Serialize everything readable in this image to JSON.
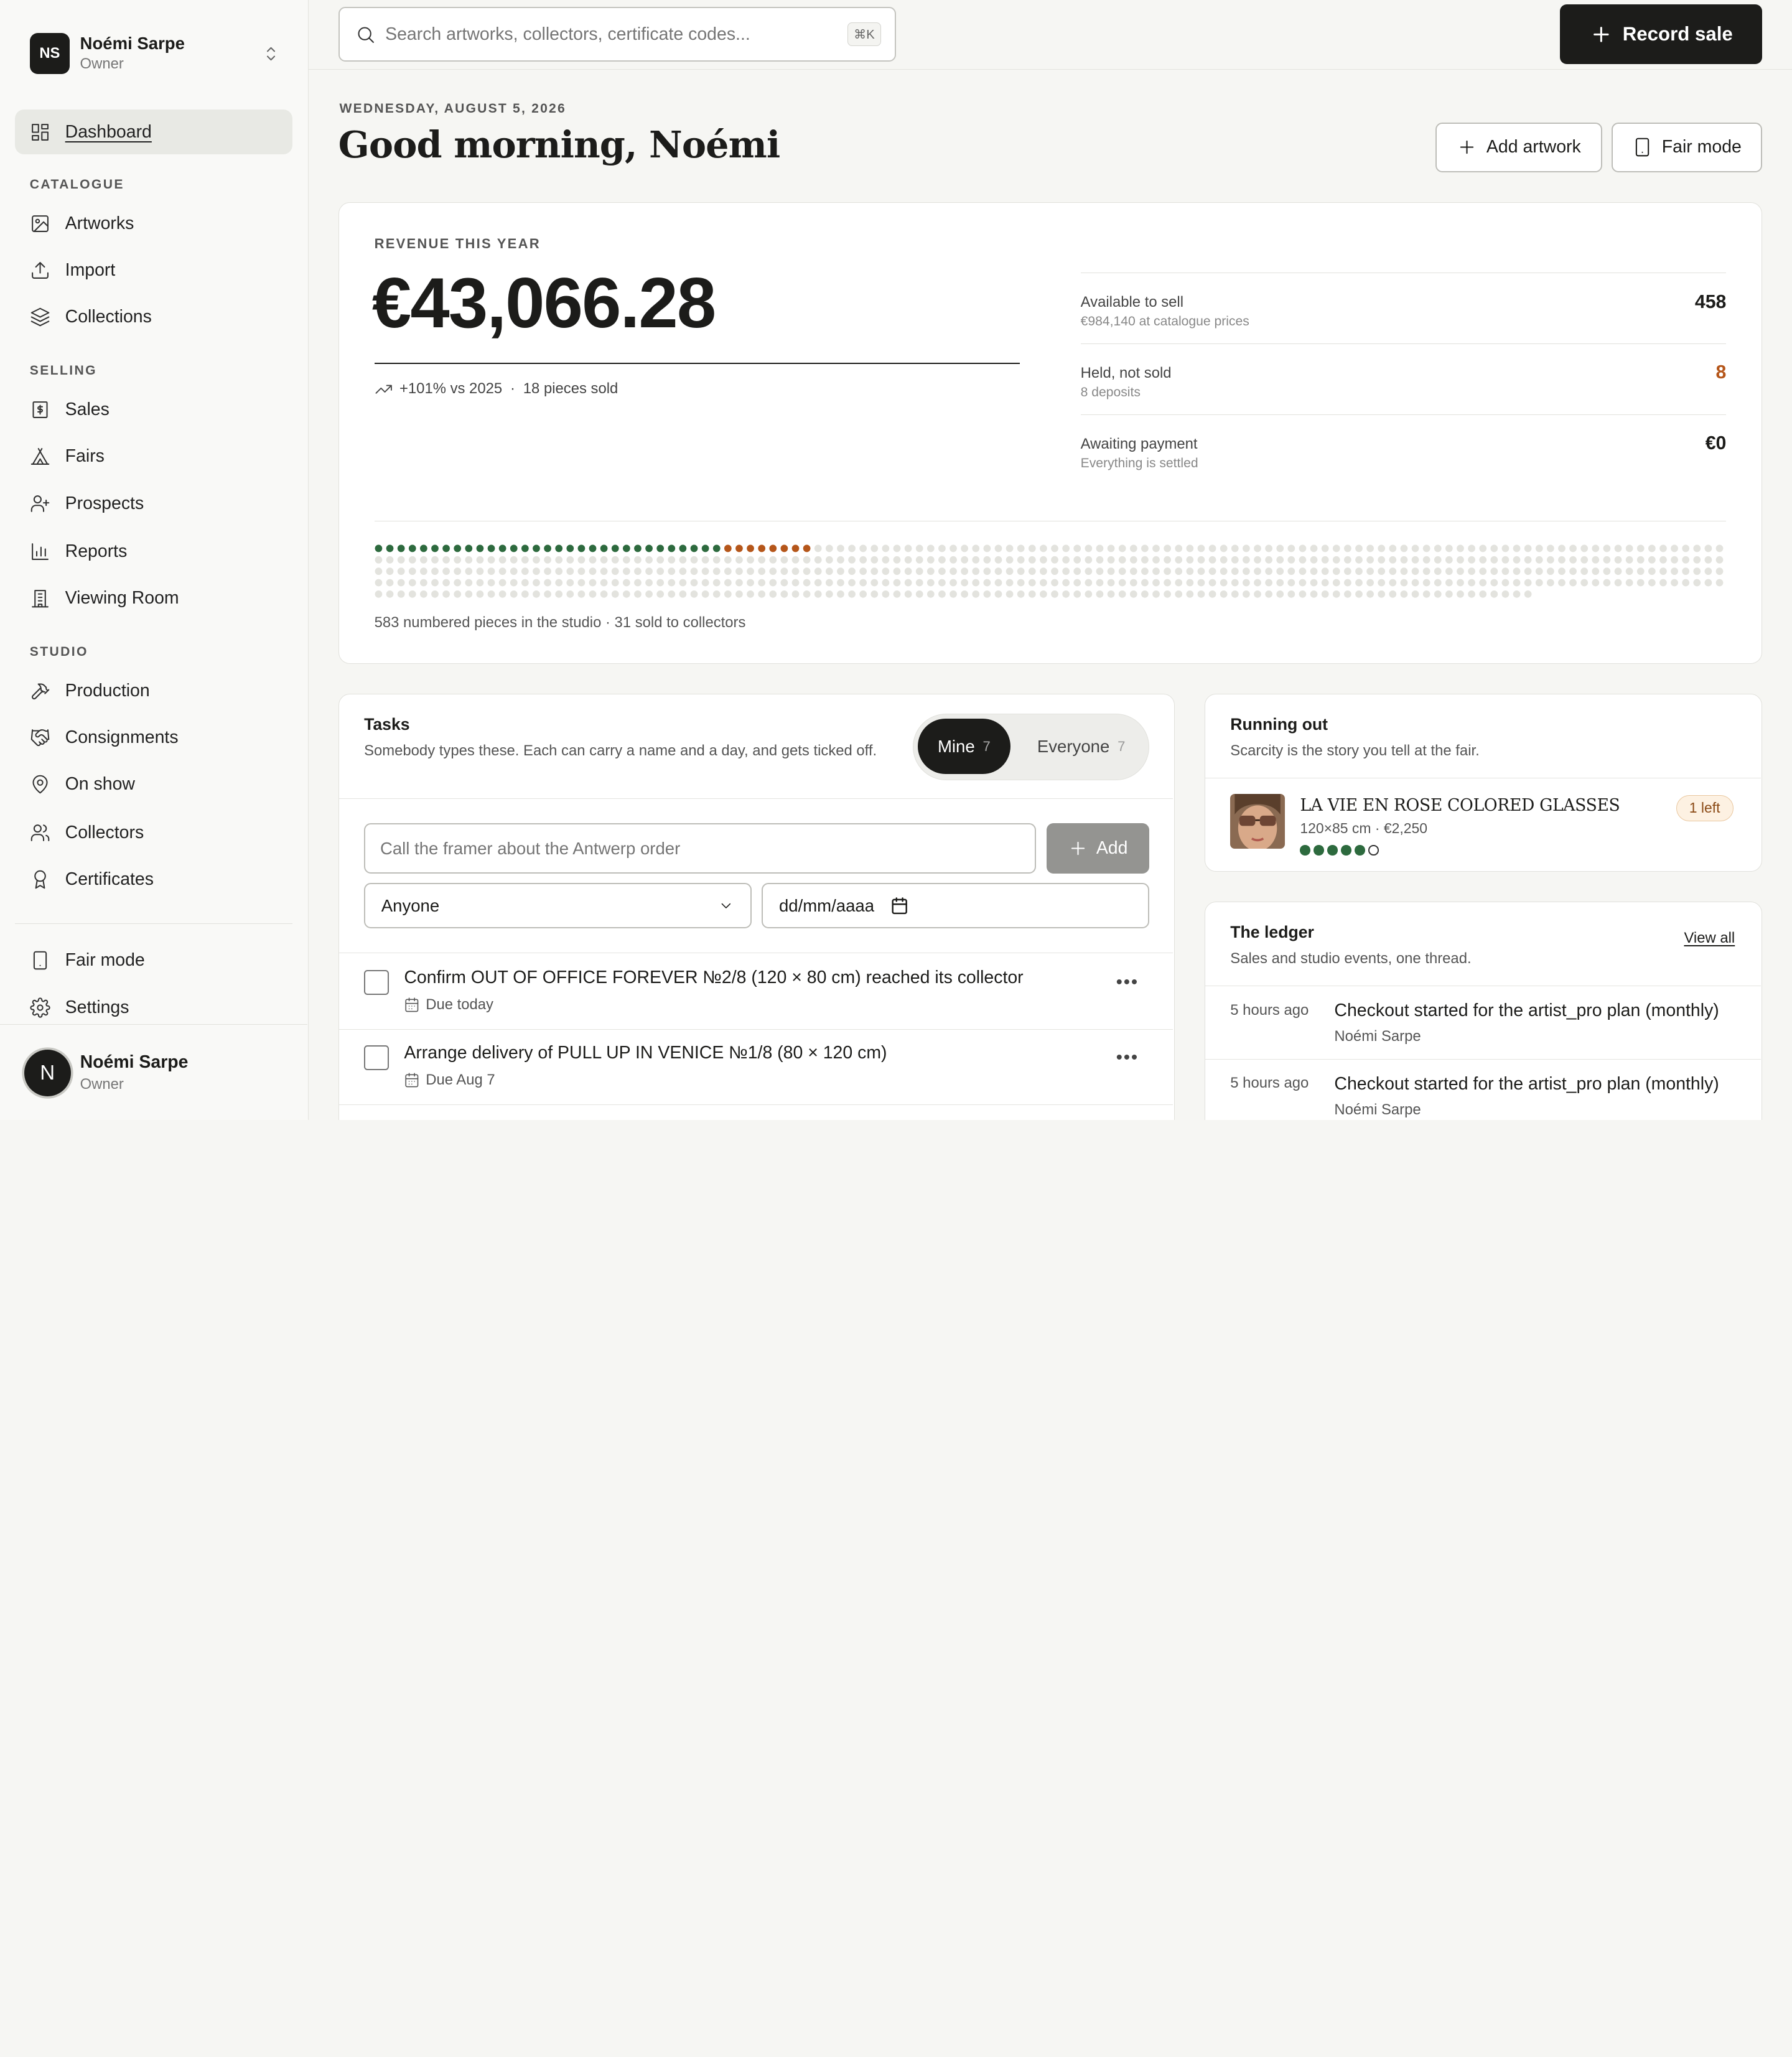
{
  "sidebar": {
    "org": {
      "initials": "NS",
      "name": "Noémi Sarpe",
      "role": "Owner"
    },
    "dashboard": "Dashboard",
    "sections": {
      "catalogue": "CATALOGUE",
      "selling": "SELLING",
      "studio": "STUDIO"
    },
    "catalogue": [
      "Artworks",
      "Import",
      "Collections"
    ],
    "selling": [
      "Sales",
      "Fairs",
      "Prospects",
      "Reports",
      "Viewing Room"
    ],
    "studio": [
      "Production",
      "Consignments",
      "On show",
      "Collectors",
      "Certificates"
    ],
    "bottom": [
      "Fair mode",
      "Settings"
    ],
    "user": {
      "initial": "N",
      "name": "Noémi Sarpe",
      "role": "Owner"
    }
  },
  "topbar": {
    "search_placeholder": "Search artworks, collectors, certificate codes...",
    "shortcut": "⌘K",
    "record_sale": "Record sale"
  },
  "header": {
    "date": "WEDNESDAY, AUGUST 5, 2026",
    "greeting": "Good morning, Noémi",
    "add_artwork": "Add artwork",
    "fair_mode": "Fair mode"
  },
  "revenue": {
    "label": "REVENUE THIS YEAR",
    "amount": "€43,066.28",
    "trend": "+101% vs 2025",
    "sep": "·",
    "pieces_sold": "18 pieces sold",
    "stats": [
      {
        "label": "Available to sell",
        "sub": "€984,140 at catalogue prices",
        "value": "458"
      },
      {
        "label": "Held, not sold",
        "sub": "8 deposits",
        "value": "8"
      },
      {
        "label": "Awaiting payment",
        "sub": "Everything is settled",
        "value": "€0"
      }
    ],
    "dots": {
      "total": 583,
      "sold": 31,
      "held": 8
    },
    "caption": "583 numbered pieces in the studio · 31 sold to collectors",
    "colors": {
      "sold": "#2d6a3e",
      "held": "#b5561a",
      "available": "#e3e3de"
    }
  },
  "tasks": {
    "title": "Tasks",
    "subtitle": "Somebody types these. Each can carry a name and a day, and gets ticked off.",
    "tabs": [
      {
        "label": "Mine",
        "count": "7"
      },
      {
        "label": "Everyone",
        "count": "7"
      }
    ],
    "input_placeholder": "Call the framer about the Antwerp order",
    "add_label": "Add",
    "assignee": "Anyone",
    "date_placeholder": "dd/mm/aaaa",
    "items": [
      {
        "title": "Confirm OUT OF OFFICE FOREVER №2/8 (120 × 80 cm) reached its collector",
        "due": "Due today"
      },
      {
        "title": "Arrange delivery of PULL UP IN VENICE №1/8 (80 × 120 cm)",
        "due": "Due Aug 7"
      }
    ]
  },
  "running_out": {
    "title": "Running out",
    "subtitle": "Scarcity is the story you tell at the fair.",
    "item": {
      "title": "LA VIE EN ROSE COLORED GLASSES",
      "meta": "120×85 cm · €2,250",
      "badge": "1 left",
      "editions_total": 6,
      "editions_sold": 5
    }
  },
  "ledger": {
    "title": "The ledger",
    "subtitle": "Sales and studio events, one thread.",
    "view_all": "View all",
    "rows": [
      {
        "time": "5 hours ago",
        "text": "Checkout started for the artist_pro plan (monthly)",
        "who": "Noémi Sarpe"
      },
      {
        "time": "5 hours ago",
        "text": "Checkout started for the artist_pro plan (monthly)",
        "who": "Noémi Sarpe"
      }
    ]
  }
}
